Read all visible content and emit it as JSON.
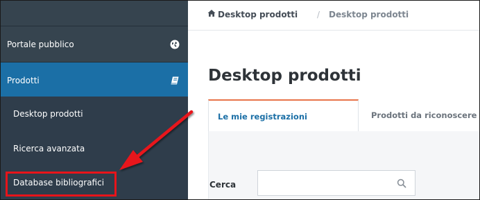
{
  "sidebar": {
    "items": [
      {
        "label": "Portale pubblico",
        "icon": "globe-icon"
      },
      {
        "label": "Prodotti",
        "icon": "book-icon",
        "active": true
      },
      {
        "label": "Desktop prodotti"
      },
      {
        "label": "Ricerca avanzata"
      },
      {
        "label": "Database bibliografici",
        "highlighted": true
      }
    ]
  },
  "breadcrumb": {
    "home_icon": "home-icon",
    "items": [
      "Desktop prodotti",
      "Desktop prodotti"
    ],
    "separator": "/"
  },
  "main": {
    "title": "Desktop prodotti",
    "tabs": [
      {
        "label": "Le mie registrazioni",
        "active": true
      },
      {
        "label": "Prodotti da riconoscere"
      }
    ],
    "search": {
      "label": "Cerca",
      "value": "",
      "icon": "search-icon"
    }
  },
  "colors": {
    "sidebar_bg": "#2f3d4b",
    "sidebar_active": "#1b6fa6",
    "accent_tab": "#e8734a",
    "annotation_red": "#e8141a",
    "link_blue": "#1b6fa6"
  }
}
